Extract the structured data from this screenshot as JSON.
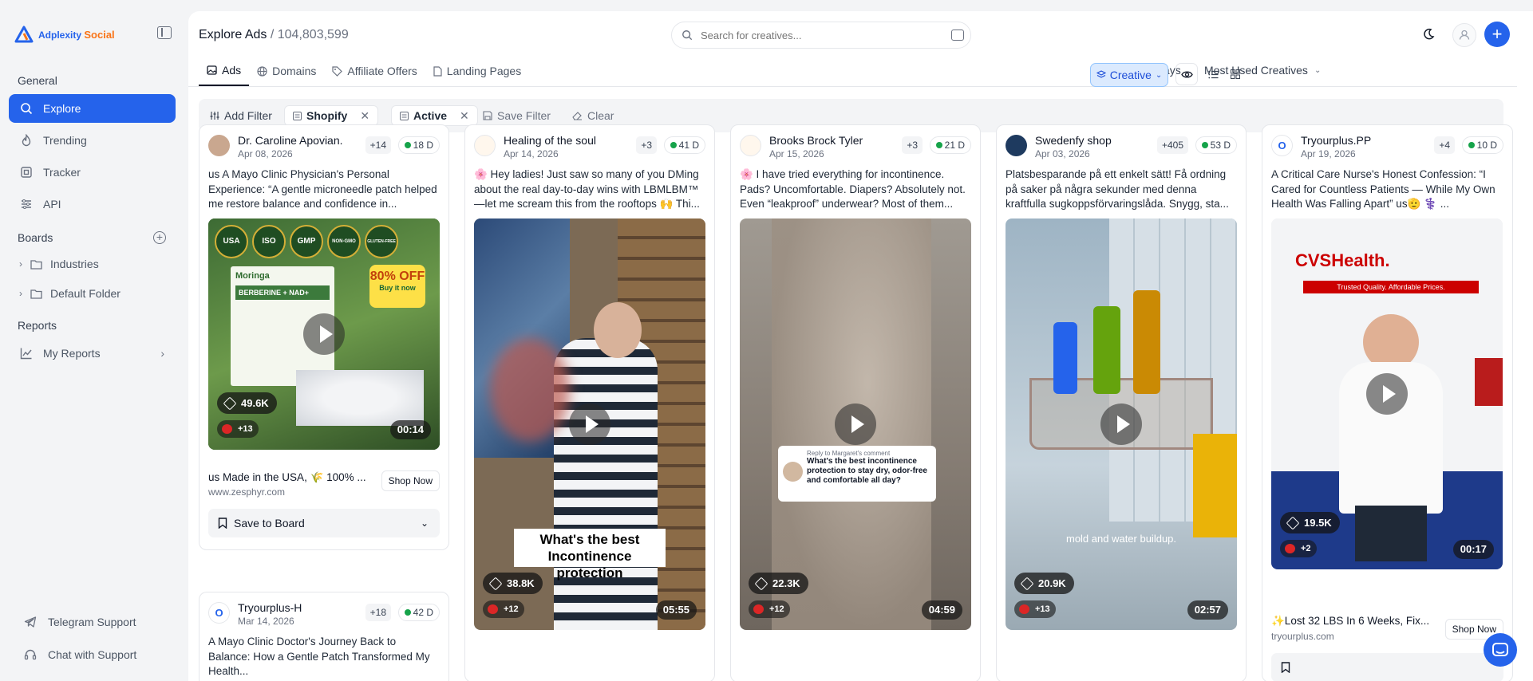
{
  "brand": {
    "name": "Adplexity",
    "product": "Social"
  },
  "sidebar": {
    "general_label": "General",
    "nav": [
      {
        "label": "Explore",
        "icon": "search-icon"
      },
      {
        "label": "Trending",
        "icon": "flame-icon"
      },
      {
        "label": "Tracker",
        "icon": "tracker-icon"
      },
      {
        "label": "API",
        "icon": "sliders-icon"
      }
    ],
    "boards_label": "Boards",
    "boards": [
      {
        "label": "Industries"
      },
      {
        "label": "Default Folder"
      }
    ],
    "reports_label": "Reports",
    "reports": [
      {
        "label": "My Reports"
      }
    ],
    "support": [
      {
        "label": "Telegram Support"
      },
      {
        "label": "Chat with Support"
      }
    ]
  },
  "header": {
    "title": "Explore Ads",
    "separator": "/",
    "count": "104,803,599",
    "search_placeholder": "Search for creatives..."
  },
  "tabs": [
    {
      "label": "Ads",
      "active": true
    },
    {
      "label": "Domains"
    },
    {
      "label": "Affiliate Offers"
    },
    {
      "label": "Landing Pages"
    }
  ],
  "toolbar": {
    "date_range": "Last 30 Days",
    "sort": "Most Used Creatives",
    "view_mode": "Creative"
  },
  "filters": {
    "add_label": "Add Filter",
    "chips": [
      {
        "label": "Shopify"
      },
      {
        "label": "Active"
      }
    ],
    "save_label": "Save Filter",
    "clear_label": "Clear"
  },
  "colors": {
    "accent": "#2563eb",
    "brand_orange": "#f97316",
    "active_dot": "#16a34a"
  },
  "cards": [
    {
      "advertiser": "Dr. Caroline Apovian.",
      "date": "Apr 08, 2026",
      "plus": "+14",
      "days": "18 D",
      "text": "us A Mayo Clinic Physician's Personal Experience: “A gentle microneedle patch helped me restore balance and confidence in...",
      "count": "49.6K",
      "flags": "+13",
      "duration": "00:14",
      "cta_text": "us Made in the USA, 🌾 100% ...",
      "url": "www.zesphyr.com",
      "cta_button": "Shop Now",
      "save_label": "Save to Board"
    },
    {
      "advertiser": "Healing of the soul",
      "date": "Apr 14, 2026",
      "plus": "+3",
      "days": "41 D",
      "text": "🌸 Hey ladies! Just saw so many of you DMing about the real day-to-day wins with LBMLBM™ —let me scream this from the rooftops 🙌 Thi...",
      "count": "38.8K",
      "flags": "+12",
      "duration": "05:55",
      "overlay": "What's the best Incontinence protection"
    },
    {
      "advertiser": "Brooks Brock Tyler",
      "date": "Apr 15, 2026",
      "plus": "+3",
      "days": "21 D",
      "text": "🌸 I have tried everything for incontinence. Pads? Uncomfortable. Diapers? Absolutely not. Even “leakproof” underwear? Most of them...",
      "count": "22.3K",
      "flags": "+12",
      "duration": "04:59",
      "reply_title": "Reply to Margaret's comment",
      "reply_text": "What's the best incontinence protection to stay dry, odor-free and comfortable all day?"
    },
    {
      "advertiser": "Swedenfy shop",
      "date": "Apr 03, 2026",
      "plus": "+405",
      "days": "53 D",
      "text": "Platsbesparande på ett enkelt sätt! Få ordning på saker på några sekunder med denna kraftfulla sugkoppsförvaringslåda. Snygg, sta...",
      "count": "20.9K",
      "flags": "+13",
      "duration": "02:57",
      "caption": "mold and water buildup."
    },
    {
      "advertiser": "Tryourplus.PP",
      "date": "Apr 19, 2026",
      "plus": "+4",
      "days": "10 D",
      "text": "A Critical Care Nurse's Honest Confession: “I Cared for Countless Patients — While My Own Health Was Falling Apart” us🫡 ⚕️ ...",
      "count": "19.5K",
      "flags": "+2",
      "duration": "00:17",
      "cta_text": "✨Lost 32 LBS In 6 Weeks, Fix...",
      "url": "tryourplus.com",
      "cta_button": "Shop Now",
      "banner_line1": "CVSHealth.",
      "banner_line2": "Trusted Quality. Affordable Prices."
    },
    {
      "advertiser": "Tryourplus-H",
      "date": "Mar 14, 2026",
      "plus": "+18",
      "days": "42 D",
      "text": "A Mayo Clinic Doctor's Journey Back to Balance: How a Gentle Patch Transformed My Health..."
    }
  ],
  "card1_badges": [
    "USA",
    "ISO",
    "GMP",
    "NON-GMO",
    "GLUTEN-FREE"
  ],
  "card1_product": {
    "brand": "Moringa",
    "name": "BERBERINE + NAD+",
    "promo": "80% OFF",
    "cta": "Buy it now"
  }
}
